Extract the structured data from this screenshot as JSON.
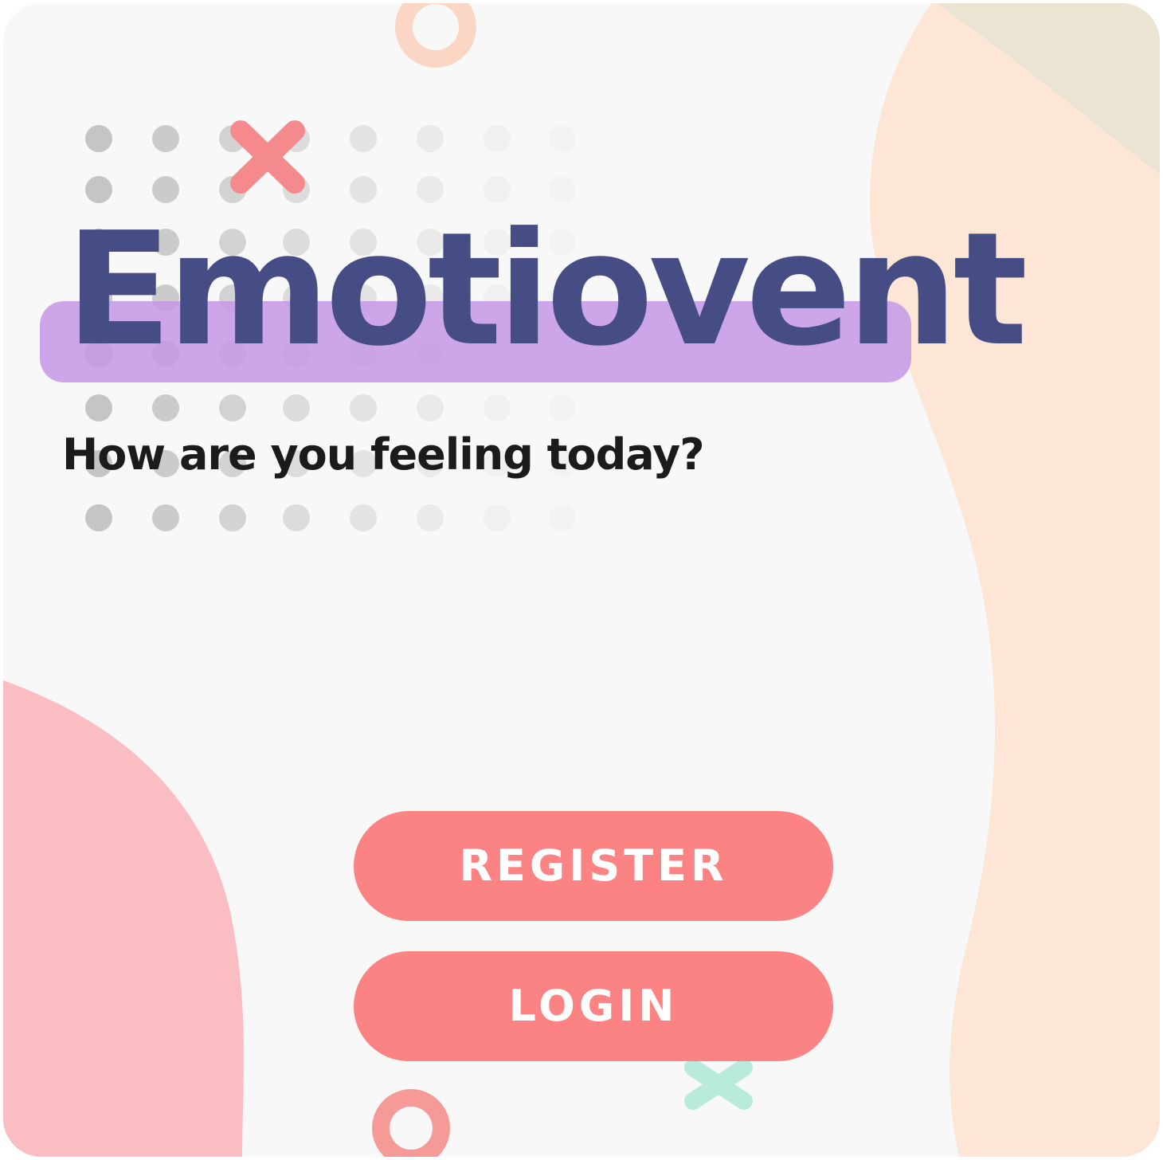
{
  "app": {
    "title": "Emotiovent",
    "tagline": "How are you feeling today?"
  },
  "actions": {
    "register_label": "REGISTER",
    "login_label": "LOGIN"
  },
  "colors": {
    "background": "#f8f8f8",
    "title": "#454d84",
    "title_highlight": "#c498e6",
    "button": "#fc8383",
    "button_text": "#ffffff",
    "peach_blob": "#fde6d6",
    "pink_blob": "#f9bdc2",
    "olive_corner": "#ebe4d2",
    "decor_cross": "#f58a8e",
    "decor_cross_mint": "#b9ebdd"
  }
}
